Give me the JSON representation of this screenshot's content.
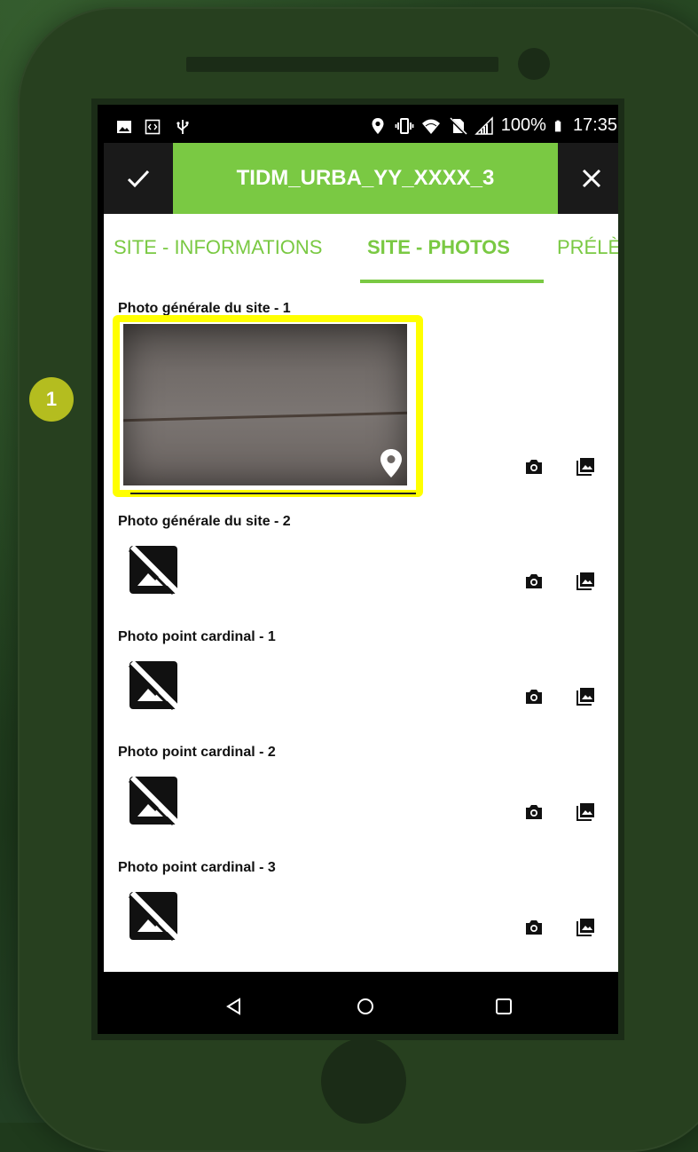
{
  "status_bar": {
    "battery": "100%",
    "time": "17:35"
  },
  "app_bar": {
    "title": "TIDM_URBA_YY_XXXX_3",
    "confirm_icon": "check-icon",
    "close_icon": "close-icon",
    "accent_color": "#7ac943"
  },
  "tabs": [
    {
      "label": "SITE - INFORMATIONS",
      "active": false
    },
    {
      "label": "SITE - PHOTOS",
      "active": true
    },
    {
      "label": "PRÉLÈ",
      "active": false
    }
  ],
  "photo_sections": [
    {
      "label": "Photo générale du site - 1",
      "has_photo": true
    },
    {
      "label": "Photo générale du site - 2",
      "has_photo": false
    },
    {
      "label": "Photo point cardinal - 1",
      "has_photo": false
    },
    {
      "label": "Photo point cardinal - 2",
      "has_photo": false
    },
    {
      "label": "Photo point cardinal - 3",
      "has_photo": false
    }
  ],
  "actions": {
    "camera_icon": "camera-icon",
    "gallery_icon": "gallery-icon"
  },
  "nav_bar": {
    "icons": [
      "back-icon",
      "home-icon",
      "recents-icon"
    ]
  },
  "callout": {
    "number": "1",
    "highlight_color": "#ffff00",
    "badge_color": "#b4bd1f"
  }
}
